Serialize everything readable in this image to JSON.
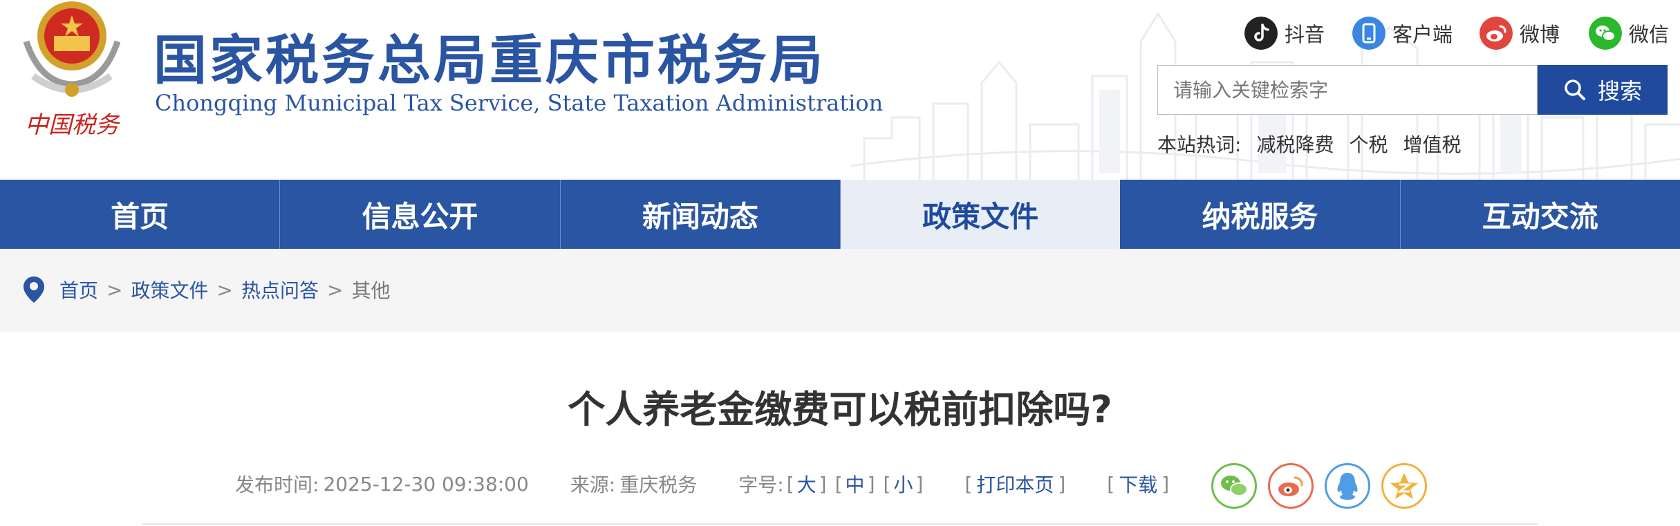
{
  "header": {
    "title": "国家税务总局重庆市税务局",
    "subtitle": "Chongqing Municipal Tax Service, State Taxation Administration",
    "logo_caption": "中国税务",
    "social": [
      {
        "label": "抖音",
        "icon": "douyin-icon",
        "color": "#222222"
      },
      {
        "label": "客户端",
        "icon": "mobile-client-icon",
        "color": "#3a86e0"
      },
      {
        "label": "微博",
        "icon": "weibo-icon",
        "color": "#e0463d"
      },
      {
        "label": "微信",
        "icon": "wechat-icon",
        "color": "#2cb82d"
      }
    ],
    "search": {
      "placeholder": "请输入关键检索字",
      "button_label": "搜索"
    },
    "hotwords": {
      "label": "本站热词:",
      "items": [
        "减税降费",
        "个税",
        "增值税"
      ]
    }
  },
  "nav": {
    "items": [
      "首页",
      "信息公开",
      "新闻动态",
      "政策文件",
      "纳税服务",
      "互动交流"
    ],
    "active": "政策文件"
  },
  "breadcrumb": {
    "items": [
      "首页",
      "政策文件",
      "热点问答"
    ],
    "current": "其他",
    "separator": ">"
  },
  "article": {
    "title": "个人养老金缴费可以税前扣除吗?",
    "publish_label": "发布时间:",
    "publish_time": "2025-12-30 09:38:00",
    "source_label": "来源:",
    "source": "重庆税务",
    "fontsize_label": "字号:",
    "fontsize_options": [
      "大",
      "中",
      "小"
    ],
    "print_label": "打印本页",
    "download_label": "下载"
  },
  "share": [
    {
      "icon": "wechat-share-icon",
      "color": "#6cbf4a"
    },
    {
      "icon": "weibo-share-icon",
      "color": "#e96b4f"
    },
    {
      "icon": "qq-share-icon",
      "color": "#4f9de6"
    },
    {
      "icon": "qzone-share-icon",
      "color": "#f2b23c"
    }
  ],
  "colors": {
    "brand_blue": "#2a55a2",
    "nav_active_bg": "#e9eef6",
    "search_button": "#1f4a9e"
  }
}
